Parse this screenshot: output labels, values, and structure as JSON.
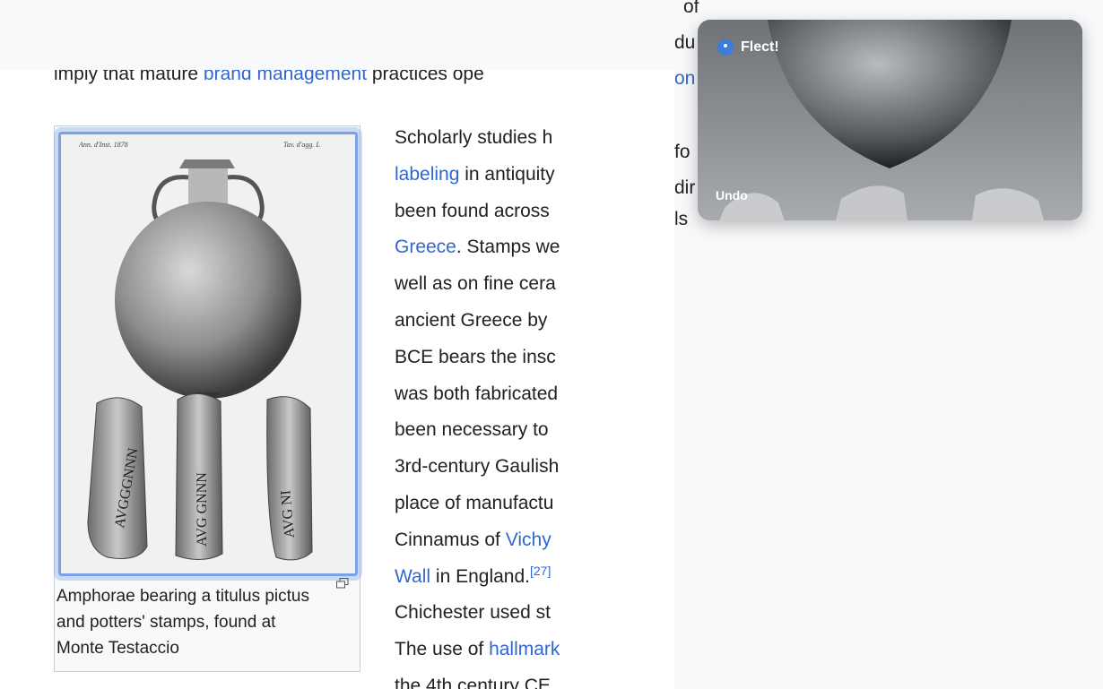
{
  "article": {
    "intro": {
      "before": "imply that mature ",
      "link": "brand management",
      "after": " practices ope"
    },
    "figure": {
      "image_alt": "Drawing of an amphora and three potters' stamp fragments",
      "stamp_texts": [
        "AVGGGNNN",
        "AVG GNNN",
        "AVG NI"
      ],
      "corner_notes": [
        "Ann. d'Inst. 1878",
        "Tav. d'agg. L"
      ],
      "caption": "Amphorae bearing a titulus pictus and potters' stamps, found at Monte Testaccio"
    },
    "body_lines": [
      {
        "pre": "Scholarly studies h",
        "link": "",
        "post": ""
      },
      {
        "pre": "",
        "link": "labeling",
        "post": " in antiquity"
      },
      {
        "pre": "been found across ",
        "link": "",
        "post": ""
      },
      {
        "pre": "",
        "link": "Greece",
        "post": ". Stamps we"
      },
      {
        "pre": "well as on fine cera",
        "link": "",
        "post": ""
      },
      {
        "pre": "ancient Greece by ",
        "link": "",
        "post": ""
      },
      {
        "pre": "BCE bears the insc",
        "link": "",
        "post": ""
      },
      {
        "pre": "was both fabricated",
        "link": "",
        "post": ""
      },
      {
        "pre": "been necessary to ",
        "link": "",
        "post": ""
      },
      {
        "pre": "3rd-century Gaulish",
        "link": "",
        "post": ""
      },
      {
        "pre": "place of manufactu",
        "link": "",
        "post": ""
      },
      {
        "pre": "Cinnamus of ",
        "link": "Vichy",
        "post": ""
      },
      {
        "pre": "",
        "link": "Wall",
        "post": " in England."
      },
      {
        "pre": "Chichester used st",
        "link": "",
        "post": ""
      },
      {
        "pre": "The use of ",
        "link": "hallmark",
        "post": ""
      },
      {
        "pre": "the 4th century CE",
        "link": "",
        "post": ""
      }
    ],
    "footnote": "[27]"
  },
  "peek_text": [
    "of",
    "du",
    "on",
    "fo",
    "dir",
    "ls"
  ],
  "overlay": {
    "title": "Flect!",
    "undo_label": "Undo"
  },
  "colors": {
    "link": "#3366cc",
    "accent": "#3b7ddd",
    "selection": "#7aa0e6"
  }
}
